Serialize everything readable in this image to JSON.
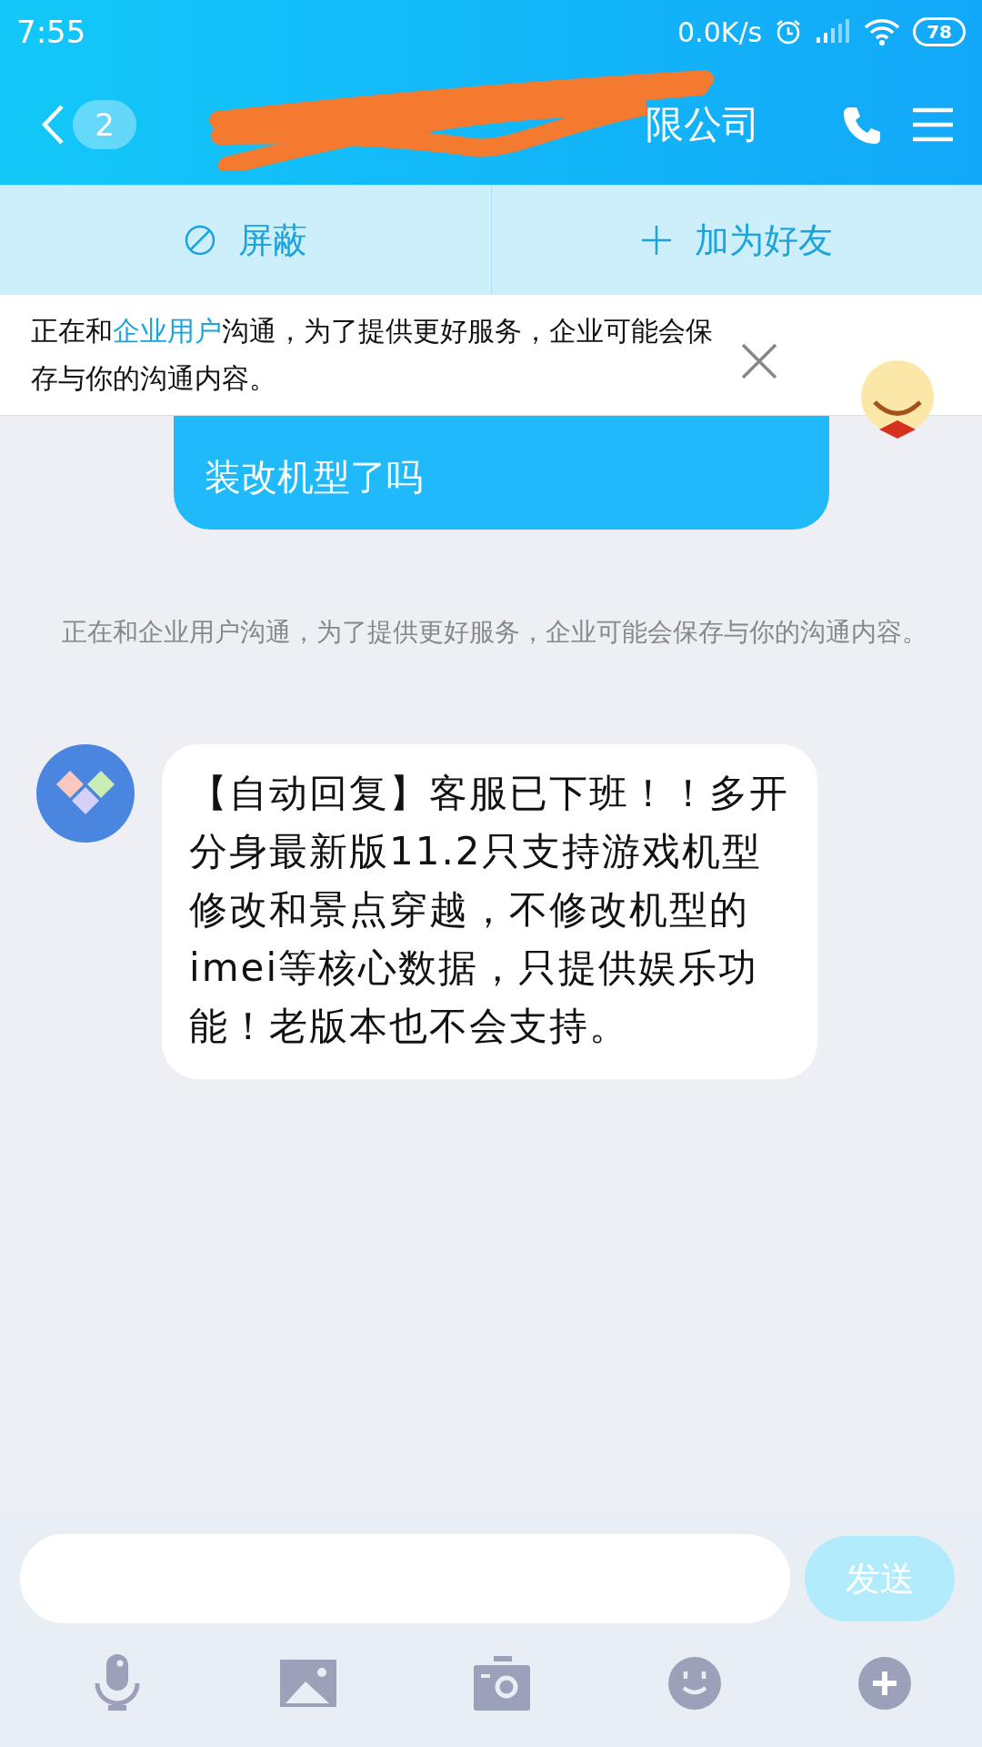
{
  "status_bar": {
    "time": "7:55",
    "speed": "0.0K/s",
    "battery": "78"
  },
  "header": {
    "back_count": "2",
    "title": "限公司"
  },
  "actions": [
    {
      "kind": "block",
      "label": "屏蔽"
    },
    {
      "kind": "add",
      "label": "加为好友"
    }
  ],
  "banner": {
    "text": "正在和**企业用户**沟通，为了提供更好服务，企业可能会保存与你的沟通内容。"
  },
  "messages": [
    {
      "kind": "outgoing",
      "text": "装改机型了吗"
    },
    {
      "kind": "system",
      "text": "正在和企业用户沟通，为了提供更好服务，企业可能会保存与你的沟通内容。"
    },
    {
      "kind": "incoming",
      "text": "【自动回复】客服已下班！！多开分身最新版11.2只支持游戏机型修改和景点穿越，不修改机型的imei等核心数据，只提供娱乐功能！老版本也不会支持。"
    }
  ],
  "composer": {
    "send": "发送",
    "send_enabled": false
  }
}
